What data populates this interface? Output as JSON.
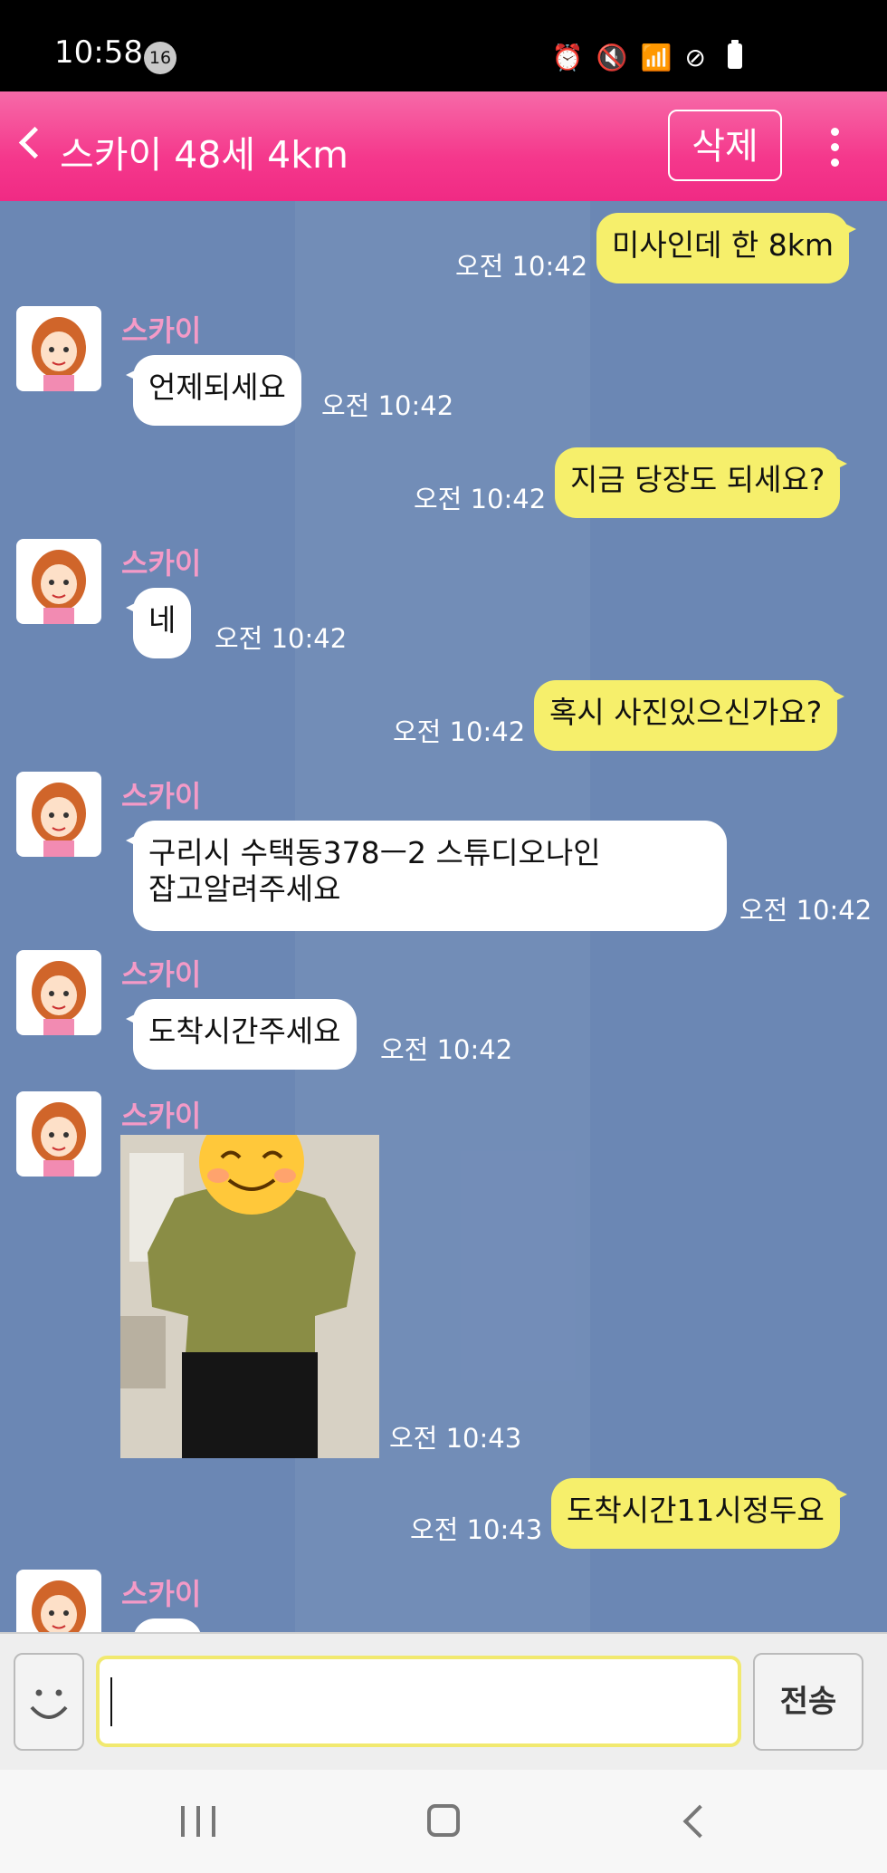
{
  "status": {
    "time": "10:58",
    "notif_count": "16"
  },
  "header": {
    "title": "스카이 48세 4km",
    "delete_label": "삭제"
  },
  "contact_name": "스카이",
  "messages": [
    {
      "dir": "out",
      "text": "미사인데 한 8km",
      "time": "오전 10:42"
    },
    {
      "dir": "in",
      "text": "언제되세요",
      "time": "오전 10:42"
    },
    {
      "dir": "out",
      "text": "지금 당장도 되세요?",
      "time": "오전 10:42"
    },
    {
      "dir": "in",
      "text": "네",
      "time": "오전 10:42"
    },
    {
      "dir": "out",
      "text": "혹시 사진있으신가요?",
      "time": "오전 10:42"
    },
    {
      "dir": "in",
      "text": "구리시 수택동378ㅡ2 스튜디오나인\n잡고알려주세요",
      "time": "오전 10:42"
    },
    {
      "dir": "in",
      "text": "도착시간주세요",
      "time": "오전 10:42"
    },
    {
      "dir": "in",
      "type": "image",
      "time": "오전 10:43"
    },
    {
      "dir": "out",
      "text": "도착시간11시정두요",
      "time": "오전 10:43"
    },
    {
      "dir": "in",
      "text": "",
      "time": ""
    }
  ],
  "composer": {
    "value": "",
    "send_label": "전송"
  }
}
